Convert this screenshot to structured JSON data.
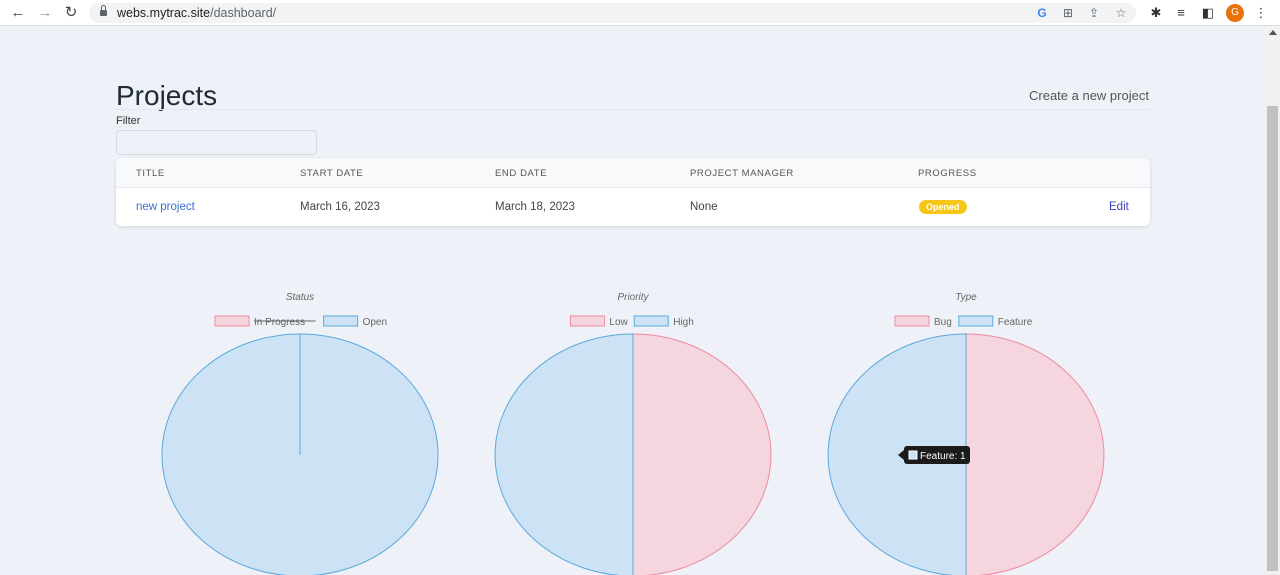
{
  "browser": {
    "url_host": "webs.mytrac.site",
    "url_path": "/dashboard/",
    "profile_initial": "G"
  },
  "page": {
    "title": "Projects",
    "create_link": "Create a new project",
    "filter_label": "Filter",
    "filter_value": ""
  },
  "table": {
    "headers": [
      "TITLE",
      "START DATE",
      "END DATE",
      "PROJECT MANAGER",
      "PROGRESS"
    ],
    "rows": [
      {
        "title": "new project",
        "start_date": "March 16, 2023",
        "end_date": "March 18, 2023",
        "manager": "None",
        "progress": "Opened",
        "action": "Edit"
      }
    ]
  },
  "colors": {
    "pink_fill": "#f5d6de",
    "pink_stroke": "#ef8aa0",
    "blue_fill": "#cde3f5",
    "blue_stroke": "#5aa9dd",
    "badge": "#f5c518",
    "link": "#3b6fd8"
  },
  "chart_data": [
    {
      "type": "pie",
      "title": "Status",
      "categories": [
        "In Progress",
        "Open"
      ],
      "values": [
        0,
        1
      ],
      "hidden": [
        "In Progress"
      ]
    },
    {
      "type": "pie",
      "title": "Priority",
      "categories": [
        "Low",
        "High"
      ],
      "values": [
        1,
        1
      ]
    },
    {
      "type": "pie",
      "title": "Type",
      "categories": [
        "Bug",
        "Feature"
      ],
      "values": [
        1,
        1
      ],
      "tooltip": "Feature: 1"
    }
  ]
}
